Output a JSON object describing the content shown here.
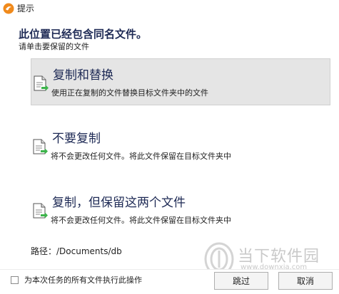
{
  "window": {
    "title": "提示"
  },
  "dialog": {
    "heading": "此位置已经包含同名文件。",
    "subheading": "请单击要保留的文件"
  },
  "options": [
    {
      "title": "复制和替换",
      "description": "使用正在复制的文件替换目标文件夹中的文件",
      "selected": true
    },
    {
      "title": "不要复制",
      "description": "将不会更改任何文件。将此文件保留在目标文件夹中",
      "selected": false
    },
    {
      "title": "复制，但保留这两个文件",
      "description": "将不会更改任何文件。将此文件保留在目标文件夹中",
      "selected": false
    }
  ],
  "path": {
    "text": "路径：/Documents/db"
  },
  "footer": {
    "checkbox_label": "为本次任务的所有文件执行此操作",
    "checkbox_checked": false,
    "skip_label": "跳过",
    "cancel_label": "取消"
  },
  "watermark": {
    "text": "当下软件园",
    "url": "www.downxia.com"
  },
  "colors": {
    "accent_green": "#3cb44b",
    "app_orange": "#f08a1c",
    "heading_navy": "#1e2a55",
    "selected_bg": "#e5e5e5"
  },
  "icons": {
    "app": "app-logo-icon",
    "file": "file-arrow-icon"
  }
}
